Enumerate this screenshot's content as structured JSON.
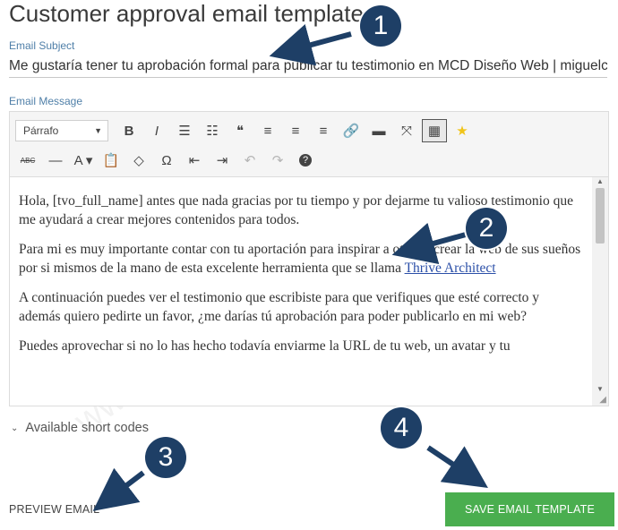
{
  "page": {
    "title": "Customer approval email template",
    "watermark": "www.miguelcanobuitrago.com"
  },
  "subject": {
    "label": "Email Subject",
    "value": "Me gustaría tener tu aprobación formal para publicar tu testimonio en MCD Diseño Web | miguelcar"
  },
  "message": {
    "label": "Email Message",
    "format_select": "Párrafo",
    "paragraphs": [
      {
        "text": "Hola, [tvo_full_name] antes que nada gracias por tu tiempo y por dejarme tu valioso testimonio que me ayudará a crear mejores contenidos para todos."
      },
      {
        "text": "Para mi es muy importante contar con tu aportación para inspirar a otros a crear la web de sus sueños por si mismos de la mano de esta excelente herramienta que se llama ",
        "link": "Thrive Architect"
      },
      {
        "text": "A continuación puedes ver el testimonio que escribiste para que verifiques que esté correcto y además quiero pedirte un favor, ¿me darías tú aprobación para poder publicarlo en mi web?"
      },
      {
        "text": "Puedes aprovechar si no lo has hecho todavía enviarme la URL de tu web, un avatar y tu"
      }
    ]
  },
  "toolbar": {
    "row1": [
      {
        "name": "bold-icon",
        "glyph": "B"
      },
      {
        "name": "italic-icon",
        "glyph": "I"
      },
      {
        "name": "bullet-list-icon",
        "glyph": "☰"
      },
      {
        "name": "numbered-list-icon",
        "glyph": "☷"
      },
      {
        "name": "blockquote-icon",
        "glyph": "❝"
      },
      {
        "name": "align-left-icon",
        "glyph": "≡"
      },
      {
        "name": "align-center-icon",
        "glyph": "≡"
      },
      {
        "name": "align-right-icon",
        "glyph": "≡"
      },
      {
        "name": "link-icon",
        "glyph": "🔗"
      },
      {
        "name": "read-more-icon",
        "glyph": "▬"
      },
      {
        "name": "fullscreen-icon",
        "glyph": "⤧"
      },
      {
        "name": "toolbar-toggle-icon",
        "glyph": "▦"
      },
      {
        "name": "star-icon",
        "glyph": "★"
      }
    ],
    "row2": [
      {
        "name": "strikethrough-icon",
        "glyph": "ABC"
      },
      {
        "name": "horizontal-line-icon",
        "glyph": "—"
      },
      {
        "name": "text-color-icon",
        "glyph": "A ▾"
      },
      {
        "name": "paste-text-icon",
        "glyph": "📋"
      },
      {
        "name": "clear-formatting-icon",
        "glyph": "◇"
      },
      {
        "name": "special-character-icon",
        "glyph": "Ω"
      },
      {
        "name": "outdent-icon",
        "glyph": "⇤"
      },
      {
        "name": "indent-icon",
        "glyph": "⇥"
      },
      {
        "name": "undo-icon",
        "glyph": "↶"
      },
      {
        "name": "redo-icon",
        "glyph": "↷"
      },
      {
        "name": "help-icon",
        "glyph": "?"
      }
    ]
  },
  "short_codes": {
    "label": "Available short codes",
    "icon": "chevron-down-icon"
  },
  "actions": {
    "preview_label": "PREVIEW EMAIL",
    "save_label": "SAVE EMAIL TEMPLATE"
  },
  "annotations": [
    "1",
    "2",
    "3",
    "4"
  ],
  "colors": {
    "save_button": "#4aae4f",
    "badge": "#1e3f66",
    "link": "#2b4fa8",
    "label": "#4f7fa8"
  }
}
